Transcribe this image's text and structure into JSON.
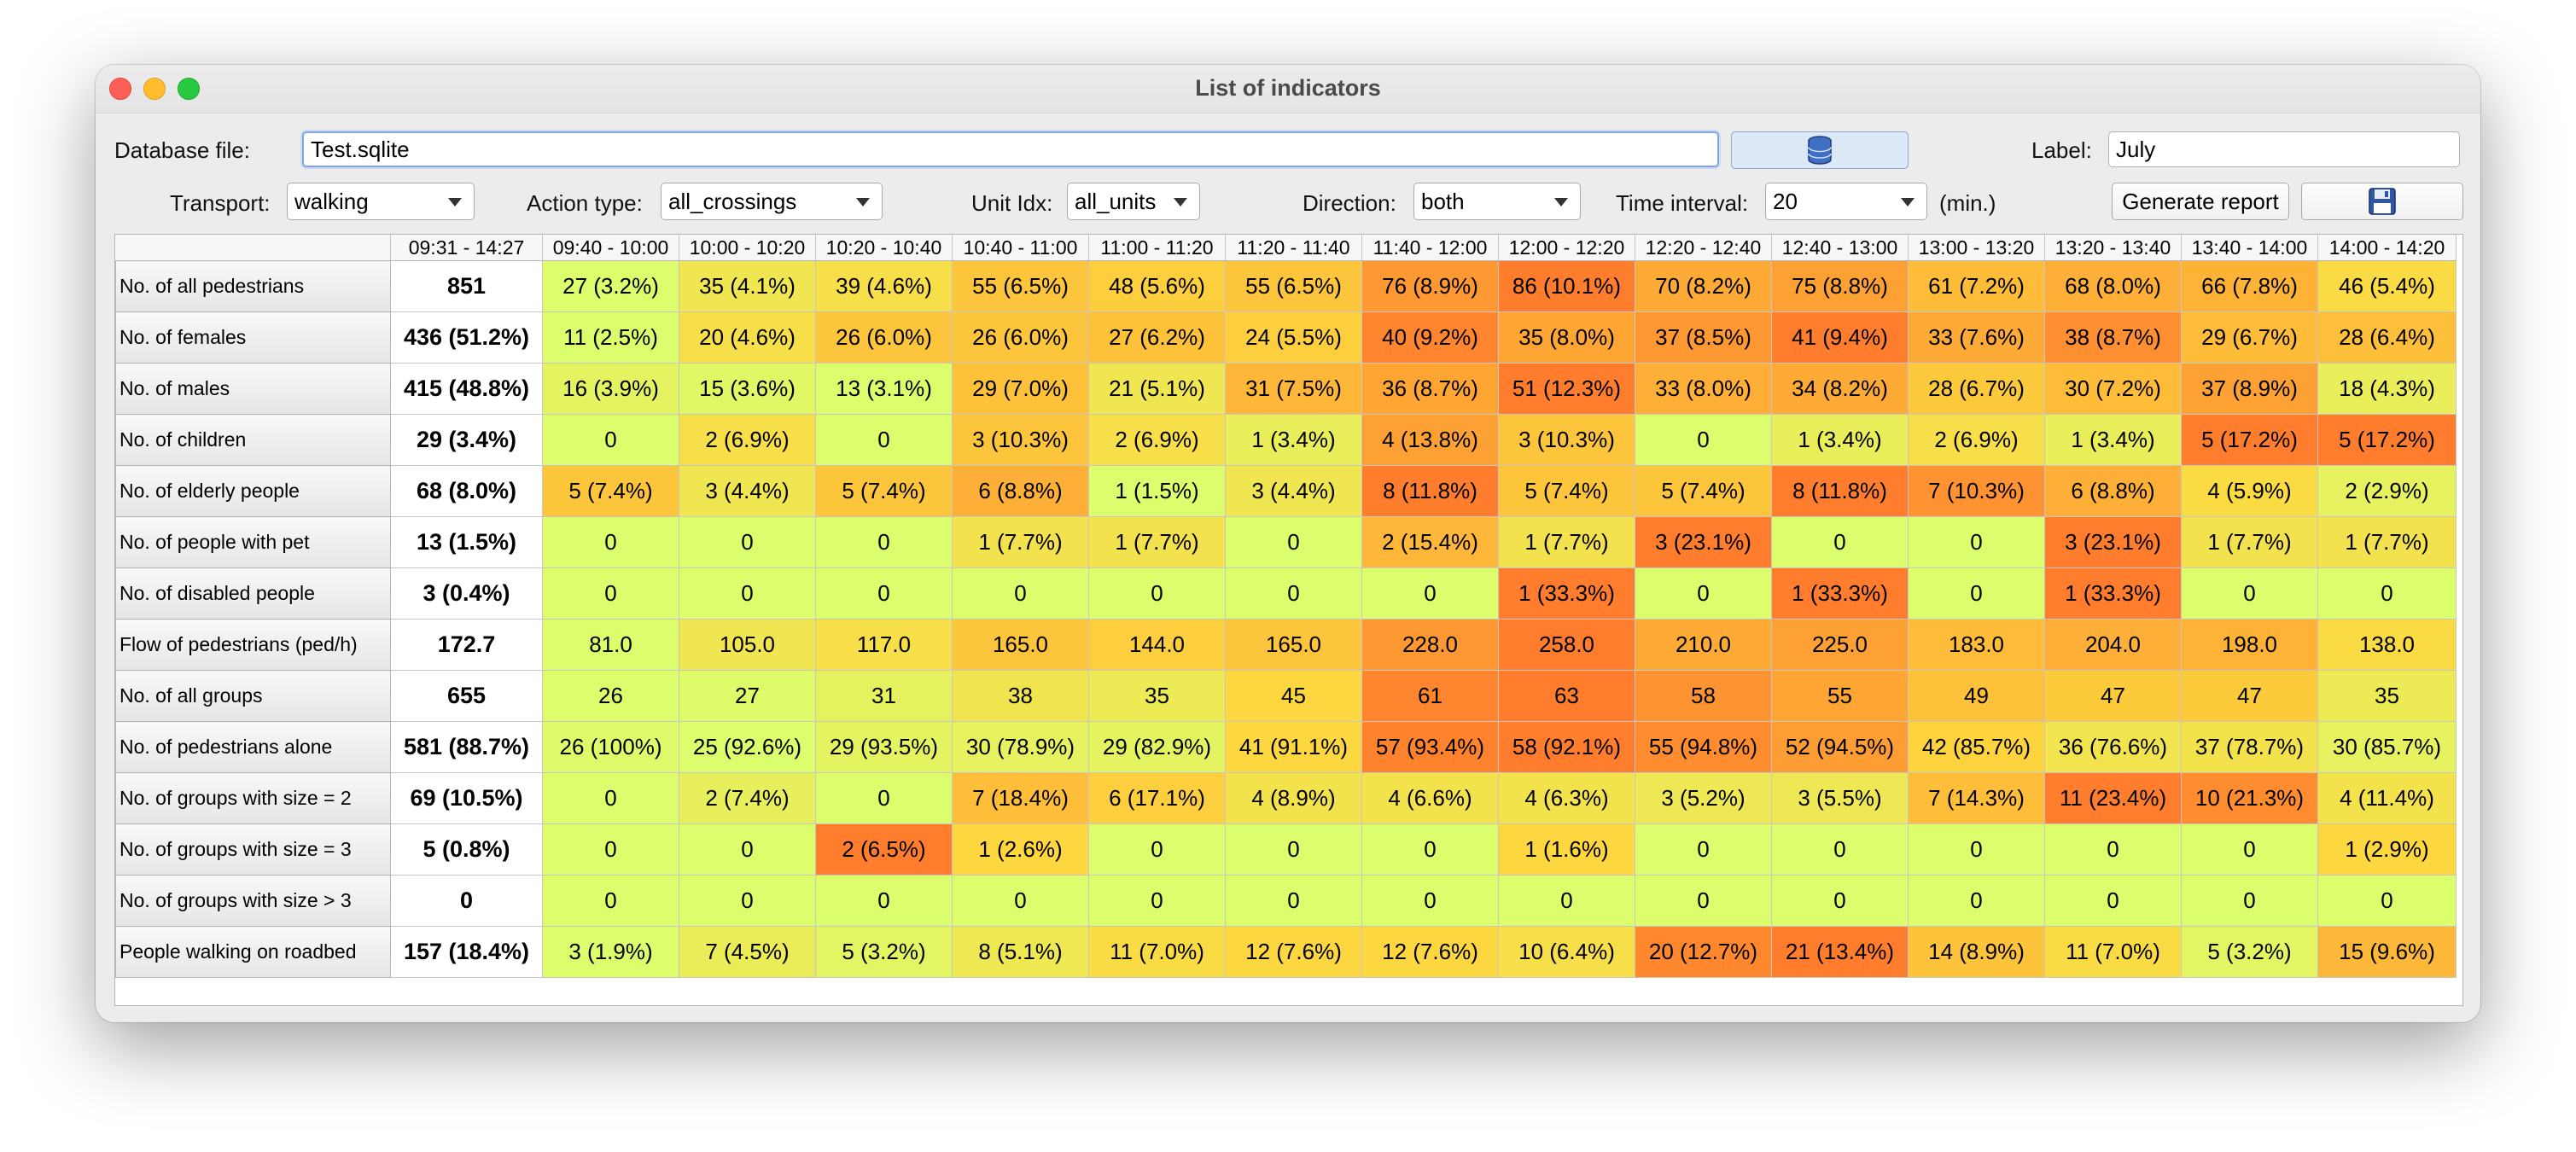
{
  "window": {
    "title": "List of indicators"
  },
  "database": {
    "label": "Database file:",
    "value": "Test.sqlite",
    "button_icon": "database-icon"
  },
  "label_field": {
    "label": "Label:",
    "value": "July"
  },
  "controls": {
    "transport": {
      "label": "Transport:",
      "value": "walking"
    },
    "action_type": {
      "label": "Action type:",
      "value": "all_crossings"
    },
    "unit_idx": {
      "label": "Unit Idx:",
      "value": "all_units"
    },
    "direction": {
      "label": "Direction:",
      "value": "both"
    },
    "time_interval": {
      "label": "Time interval:",
      "value": "20",
      "unit": "(min.)"
    },
    "generate_report": "Generate report",
    "save_icon": "floppy-disk-icon"
  },
  "heat_colors": {
    "low": "#dcfd6c",
    "mid": "#fdd73f",
    "high": "#ff7d2c"
  },
  "table": {
    "columns": [
      "09:31 - 14:27",
      "09:40 - 10:00",
      "10:00 - 10:20",
      "10:20 - 10:40",
      "10:40 - 11:00",
      "11:00 - 11:20",
      "11:20 - 11:40",
      "11:40 - 12:00",
      "12:00 - 12:20",
      "12:20 - 12:40",
      "12:40 - 13:00",
      "13:00 - 13:20",
      "13:20 - 13:40",
      "13:40 - 14:00",
      "14:00 - 14:20"
    ],
    "rows": [
      {
        "label": "No. of all pedestrians",
        "total": "851",
        "cells": [
          "27 (3.2%)",
          "35 (4.1%)",
          "39 (4.6%)",
          "55 (6.5%)",
          "48 (5.6%)",
          "55 (6.5%)",
          "76 (8.9%)",
          "86 (10.1%)",
          "70 (8.2%)",
          "75 (8.8%)",
          "61 (7.2%)",
          "68 (8.0%)",
          "66 (7.8%)",
          "46 (5.4%)"
        ],
        "heat": [
          0.0,
          0.3,
          0.4,
          0.6,
          0.55,
          0.6,
          0.85,
          1.0,
          0.75,
          0.8,
          0.65,
          0.72,
          0.7,
          0.45
        ]
      },
      {
        "label": "No. of females",
        "total": "436 (51.2%)",
        "cells": [
          "11 (2.5%)",
          "20 (4.6%)",
          "26 (6.0%)",
          "26 (6.0%)",
          "27 (6.2%)",
          "24 (5.5%)",
          "40 (9.2%)",
          "35 (8.0%)",
          "37 (8.5%)",
          "41 (9.4%)",
          "33 (7.6%)",
          "38 (8.7%)",
          "29 (6.7%)",
          "28 (6.4%)"
        ],
        "heat": [
          0.0,
          0.4,
          0.6,
          0.6,
          0.62,
          0.55,
          0.95,
          0.78,
          0.85,
          1.0,
          0.75,
          0.9,
          0.65,
          0.63
        ]
      },
      {
        "label": "No. of males",
        "total": "415 (48.8%)",
        "cells": [
          "16 (3.9%)",
          "15 (3.6%)",
          "13 (3.1%)",
          "29 (7.0%)",
          "21 (5.1%)",
          "31 (7.5%)",
          "36 (8.7%)",
          "51 (12.3%)",
          "33 (8.0%)",
          "34 (8.2%)",
          "28 (6.7%)",
          "30 (7.2%)",
          "37 (8.9%)",
          "18 (4.3%)"
        ],
        "heat": [
          0.12,
          0.08,
          0.0,
          0.62,
          0.3,
          0.68,
          0.78,
          1.0,
          0.72,
          0.75,
          0.58,
          0.65,
          0.8,
          0.2
        ]
      },
      {
        "label": "No. of children",
        "total": "29 (3.4%)",
        "cells": [
          "0",
          "2 (6.9%)",
          "0",
          "3 (10.3%)",
          "2 (6.9%)",
          "1 (3.4%)",
          "4 (13.8%)",
          "3 (10.3%)",
          "0",
          "1 (3.4%)",
          "2 (6.9%)",
          "1 (3.4%)",
          "5 (17.2%)",
          "5 (17.2%)"
        ],
        "heat": [
          0.0,
          0.4,
          0.0,
          0.6,
          0.4,
          0.2,
          0.8,
          0.6,
          0.0,
          0.2,
          0.4,
          0.2,
          1.0,
          1.0
        ]
      },
      {
        "label": "No. of elderly people",
        "total": "68 (8.0%)",
        "cells": [
          "5 (7.4%)",
          "3 (4.4%)",
          "5 (7.4%)",
          "6 (8.8%)",
          "1 (1.5%)",
          "3 (4.4%)",
          "8 (11.8%)",
          "5 (7.4%)",
          "5 (7.4%)",
          "8 (11.8%)",
          "7 (10.3%)",
          "6 (8.8%)",
          "4 (5.9%)",
          "2 (2.9%)"
        ],
        "heat": [
          0.6,
          0.3,
          0.6,
          0.72,
          0.0,
          0.3,
          1.0,
          0.6,
          0.6,
          1.0,
          0.88,
          0.72,
          0.45,
          0.15
        ]
      },
      {
        "label": "No. of people with pet",
        "total": "13 (1.5%)",
        "cells": [
          "0",
          "0",
          "0",
          "1 (7.7%)",
          "1 (7.7%)",
          "0",
          "2 (15.4%)",
          "1 (7.7%)",
          "3 (23.1%)",
          "0",
          "0",
          "3 (23.1%)",
          "1 (7.7%)",
          "1 (7.7%)"
        ],
        "heat": [
          0.0,
          0.0,
          0.0,
          0.35,
          0.35,
          0.0,
          0.68,
          0.35,
          1.0,
          0.0,
          0.0,
          1.0,
          0.35,
          0.35
        ]
      },
      {
        "label": "No. of disabled people",
        "total": "3 (0.4%)",
        "cells": [
          "0",
          "0",
          "0",
          "0",
          "0",
          "0",
          "0",
          "1 (33.3%)",
          "0",
          "1 (33.3%)",
          "0",
          "1 (33.3%)",
          "0",
          "0"
        ],
        "heat": [
          0.0,
          0.0,
          0.0,
          0.0,
          0.0,
          0.0,
          0.0,
          1.0,
          0.0,
          1.0,
          0.0,
          1.0,
          0.0,
          0.0
        ]
      },
      {
        "label": "Flow of pedestrians (ped/h)",
        "total": "172.7",
        "cells": [
          "81.0",
          "105.0",
          "117.0",
          "165.0",
          "144.0",
          "165.0",
          "228.0",
          "258.0",
          "210.0",
          "225.0",
          "183.0",
          "204.0",
          "198.0",
          "138.0"
        ],
        "heat": [
          0.0,
          0.3,
          0.4,
          0.6,
          0.55,
          0.6,
          0.85,
          1.0,
          0.75,
          0.8,
          0.65,
          0.72,
          0.7,
          0.45
        ]
      },
      {
        "label": "No. of all groups",
        "total": "655",
        "cells": [
          "26",
          "27",
          "31",
          "38",
          "35",
          "45",
          "61",
          "63",
          "58",
          "55",
          "49",
          "47",
          "47",
          "35"
        ],
        "heat": [
          0.0,
          0.03,
          0.14,
          0.32,
          0.24,
          0.5,
          0.95,
          1.0,
          0.87,
          0.78,
          0.62,
          0.57,
          0.57,
          0.24
        ]
      },
      {
        "label": "No. of pedestrians alone",
        "total": "581 (88.7%)",
        "cells": [
          "26 (100%)",
          "25 (92.6%)",
          "29 (93.5%)",
          "30 (78.9%)",
          "29 (82.9%)",
          "41 (91.1%)",
          "57 (93.4%)",
          "58 (92.1%)",
          "55 (94.8%)",
          "52 (94.5%)",
          "42 (85.7%)",
          "36 (76.6%)",
          "37 (78.7%)",
          "30 (85.7%)"
        ],
        "heat": [
          0.03,
          0.0,
          0.12,
          0.15,
          0.12,
          0.5,
          0.97,
          1.0,
          0.91,
          0.82,
          0.52,
          0.33,
          0.36,
          0.15
        ]
      },
      {
        "label": "No. of groups with size = 2",
        "total": "69 (10.5%)",
        "cells": [
          "0",
          "2 (7.4%)",
          "0",
          "7 (18.4%)",
          "6 (17.1%)",
          "4 (8.9%)",
          "4 (6.6%)",
          "4 (6.3%)",
          "3 (5.2%)",
          "3 (5.5%)",
          "7 (14.3%)",
          "11 (23.4%)",
          "10 (21.3%)",
          "4 (11.4%)"
        ],
        "heat": [
          0.0,
          0.18,
          0.0,
          0.64,
          0.55,
          0.36,
          0.36,
          0.36,
          0.27,
          0.27,
          0.64,
          1.0,
          0.91,
          0.36
        ]
      },
      {
        "label": "No. of groups with size = 3",
        "total": "5 (0.8%)",
        "cells": [
          "0",
          "0",
          "2 (6.5%)",
          "1 (2.6%)",
          "0",
          "0",
          "0",
          "1 (1.6%)",
          "0",
          "0",
          "0",
          "0",
          "0",
          "1 (2.9%)"
        ],
        "heat": [
          0.0,
          0.0,
          1.0,
          0.5,
          0.0,
          0.0,
          0.0,
          0.5,
          0.0,
          0.0,
          0.0,
          0.0,
          0.0,
          0.5
        ]
      },
      {
        "label": "No. of groups with size > 3",
        "total": "0",
        "cells": [
          "0",
          "0",
          "0",
          "0",
          "0",
          "0",
          "0",
          "0",
          "0",
          "0",
          "0",
          "0",
          "0",
          "0"
        ],
        "heat": [
          0,
          0,
          0,
          0,
          0,
          0,
          0,
          0,
          0,
          0,
          0,
          0,
          0,
          0
        ]
      },
      {
        "label": "People walking on roadbed",
        "total": "157 (18.4%)",
        "cells": [
          "3 (1.9%)",
          "7 (4.5%)",
          "5 (3.2%)",
          "8 (5.1%)",
          "11 (7.0%)",
          "12 (7.6%)",
          "12 (7.6%)",
          "10 (6.4%)",
          "20 (12.7%)",
          "21 (13.4%)",
          "14 (8.9%)",
          "11 (7.0%)",
          "5 (3.2%)",
          "15 (9.6%)"
        ],
        "heat": [
          0.0,
          0.22,
          0.11,
          0.28,
          0.44,
          0.5,
          0.5,
          0.39,
          0.94,
          1.0,
          0.61,
          0.44,
          0.11,
          0.67
        ]
      }
    ]
  }
}
